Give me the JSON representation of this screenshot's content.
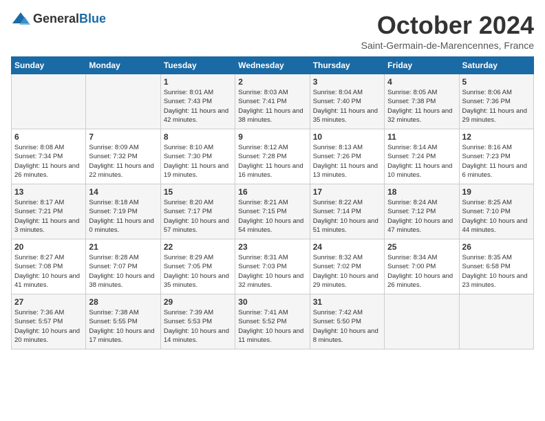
{
  "header": {
    "logo_general": "General",
    "logo_blue": "Blue",
    "month": "October 2024",
    "location": "Saint-Germain-de-Marencennes, France"
  },
  "days_of_week": [
    "Sunday",
    "Monday",
    "Tuesday",
    "Wednesday",
    "Thursday",
    "Friday",
    "Saturday"
  ],
  "weeks": [
    [
      {
        "day": "",
        "sunrise": "",
        "sunset": "",
        "daylight": ""
      },
      {
        "day": "",
        "sunrise": "",
        "sunset": "",
        "daylight": ""
      },
      {
        "day": "1",
        "sunrise": "Sunrise: 8:01 AM",
        "sunset": "Sunset: 7:43 PM",
        "daylight": "Daylight: 11 hours and 42 minutes."
      },
      {
        "day": "2",
        "sunrise": "Sunrise: 8:03 AM",
        "sunset": "Sunset: 7:41 PM",
        "daylight": "Daylight: 11 hours and 38 minutes."
      },
      {
        "day": "3",
        "sunrise": "Sunrise: 8:04 AM",
        "sunset": "Sunset: 7:40 PM",
        "daylight": "Daylight: 11 hours and 35 minutes."
      },
      {
        "day": "4",
        "sunrise": "Sunrise: 8:05 AM",
        "sunset": "Sunset: 7:38 PM",
        "daylight": "Daylight: 11 hours and 32 minutes."
      },
      {
        "day": "5",
        "sunrise": "Sunrise: 8:06 AM",
        "sunset": "Sunset: 7:36 PM",
        "daylight": "Daylight: 11 hours and 29 minutes."
      }
    ],
    [
      {
        "day": "6",
        "sunrise": "Sunrise: 8:08 AM",
        "sunset": "Sunset: 7:34 PM",
        "daylight": "Daylight: 11 hours and 26 minutes."
      },
      {
        "day": "7",
        "sunrise": "Sunrise: 8:09 AM",
        "sunset": "Sunset: 7:32 PM",
        "daylight": "Daylight: 11 hours and 22 minutes."
      },
      {
        "day": "8",
        "sunrise": "Sunrise: 8:10 AM",
        "sunset": "Sunset: 7:30 PM",
        "daylight": "Daylight: 11 hours and 19 minutes."
      },
      {
        "day": "9",
        "sunrise": "Sunrise: 8:12 AM",
        "sunset": "Sunset: 7:28 PM",
        "daylight": "Daylight: 11 hours and 16 minutes."
      },
      {
        "day": "10",
        "sunrise": "Sunrise: 8:13 AM",
        "sunset": "Sunset: 7:26 PM",
        "daylight": "Daylight: 11 hours and 13 minutes."
      },
      {
        "day": "11",
        "sunrise": "Sunrise: 8:14 AM",
        "sunset": "Sunset: 7:24 PM",
        "daylight": "Daylight: 11 hours and 10 minutes."
      },
      {
        "day": "12",
        "sunrise": "Sunrise: 8:16 AM",
        "sunset": "Sunset: 7:23 PM",
        "daylight": "Daylight: 11 hours and 6 minutes."
      }
    ],
    [
      {
        "day": "13",
        "sunrise": "Sunrise: 8:17 AM",
        "sunset": "Sunset: 7:21 PM",
        "daylight": "Daylight: 11 hours and 3 minutes."
      },
      {
        "day": "14",
        "sunrise": "Sunrise: 8:18 AM",
        "sunset": "Sunset: 7:19 PM",
        "daylight": "Daylight: 11 hours and 0 minutes."
      },
      {
        "day": "15",
        "sunrise": "Sunrise: 8:20 AM",
        "sunset": "Sunset: 7:17 PM",
        "daylight": "Daylight: 10 hours and 57 minutes."
      },
      {
        "day": "16",
        "sunrise": "Sunrise: 8:21 AM",
        "sunset": "Sunset: 7:15 PM",
        "daylight": "Daylight: 10 hours and 54 minutes."
      },
      {
        "day": "17",
        "sunrise": "Sunrise: 8:22 AM",
        "sunset": "Sunset: 7:14 PM",
        "daylight": "Daylight: 10 hours and 51 minutes."
      },
      {
        "day": "18",
        "sunrise": "Sunrise: 8:24 AM",
        "sunset": "Sunset: 7:12 PM",
        "daylight": "Daylight: 10 hours and 47 minutes."
      },
      {
        "day": "19",
        "sunrise": "Sunrise: 8:25 AM",
        "sunset": "Sunset: 7:10 PM",
        "daylight": "Daylight: 10 hours and 44 minutes."
      }
    ],
    [
      {
        "day": "20",
        "sunrise": "Sunrise: 8:27 AM",
        "sunset": "Sunset: 7:08 PM",
        "daylight": "Daylight: 10 hours and 41 minutes."
      },
      {
        "day": "21",
        "sunrise": "Sunrise: 8:28 AM",
        "sunset": "Sunset: 7:07 PM",
        "daylight": "Daylight: 10 hours and 38 minutes."
      },
      {
        "day": "22",
        "sunrise": "Sunrise: 8:29 AM",
        "sunset": "Sunset: 7:05 PM",
        "daylight": "Daylight: 10 hours and 35 minutes."
      },
      {
        "day": "23",
        "sunrise": "Sunrise: 8:31 AM",
        "sunset": "Sunset: 7:03 PM",
        "daylight": "Daylight: 10 hours and 32 minutes."
      },
      {
        "day": "24",
        "sunrise": "Sunrise: 8:32 AM",
        "sunset": "Sunset: 7:02 PM",
        "daylight": "Daylight: 10 hours and 29 minutes."
      },
      {
        "day": "25",
        "sunrise": "Sunrise: 8:34 AM",
        "sunset": "Sunset: 7:00 PM",
        "daylight": "Daylight: 10 hours and 26 minutes."
      },
      {
        "day": "26",
        "sunrise": "Sunrise: 8:35 AM",
        "sunset": "Sunset: 6:58 PM",
        "daylight": "Daylight: 10 hours and 23 minutes."
      }
    ],
    [
      {
        "day": "27",
        "sunrise": "Sunrise: 7:36 AM",
        "sunset": "Sunset: 5:57 PM",
        "daylight": "Daylight: 10 hours and 20 minutes."
      },
      {
        "day": "28",
        "sunrise": "Sunrise: 7:38 AM",
        "sunset": "Sunset: 5:55 PM",
        "daylight": "Daylight: 10 hours and 17 minutes."
      },
      {
        "day": "29",
        "sunrise": "Sunrise: 7:39 AM",
        "sunset": "Sunset: 5:53 PM",
        "daylight": "Daylight: 10 hours and 14 minutes."
      },
      {
        "day": "30",
        "sunrise": "Sunrise: 7:41 AM",
        "sunset": "Sunset: 5:52 PM",
        "daylight": "Daylight: 10 hours and 11 minutes."
      },
      {
        "day": "31",
        "sunrise": "Sunrise: 7:42 AM",
        "sunset": "Sunset: 5:50 PM",
        "daylight": "Daylight: 10 hours and 8 minutes."
      },
      {
        "day": "",
        "sunrise": "",
        "sunset": "",
        "daylight": ""
      },
      {
        "day": "",
        "sunrise": "",
        "sunset": "",
        "daylight": ""
      }
    ]
  ]
}
